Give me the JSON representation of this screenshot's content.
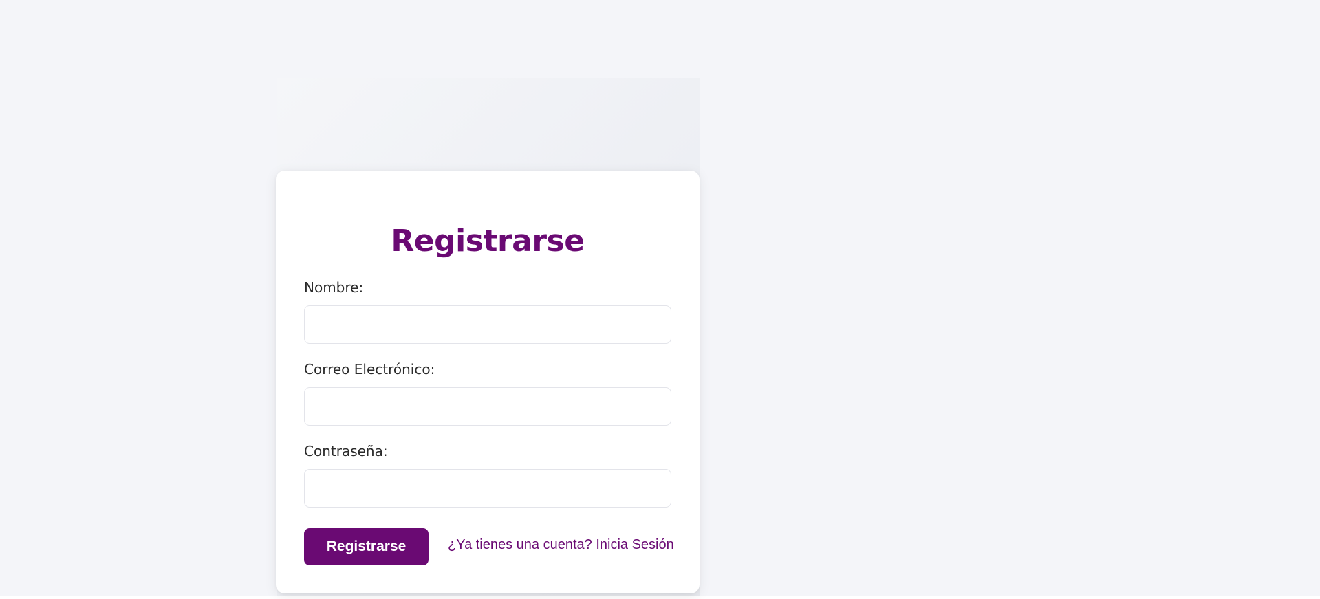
{
  "form": {
    "title": "Registrarse",
    "fields": [
      {
        "label": "Nombre:",
        "value": "",
        "placeholder": ""
      },
      {
        "label": "Correo Electrónico:",
        "value": "",
        "placeholder": ""
      },
      {
        "label": "Contraseña:",
        "value": "",
        "placeholder": ""
      }
    ],
    "submit_label": "Registrarse",
    "login_link": "¿Ya tienes una cuenta? Inicia Sesión"
  },
  "colors": {
    "accent": "#6a0a73",
    "background": "#f4f5f9",
    "card": "#ffffff",
    "text": "#2b2b2b"
  }
}
